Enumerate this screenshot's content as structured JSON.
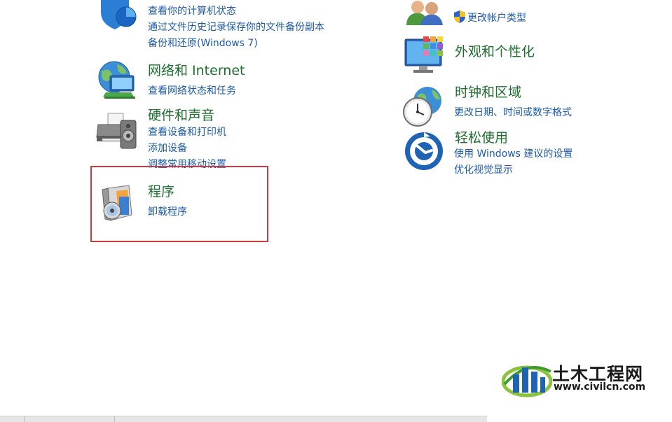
{
  "left_column": [
    {
      "id": "system-security",
      "title": "",
      "links": [
        "查看你的计算机状态",
        "通过文件历史记录保存你的文件备份副本",
        "备份和还原(Windows 7)"
      ]
    },
    {
      "id": "network",
      "title": "网络和 Internet",
      "links": [
        "查看网络状态和任务"
      ]
    },
    {
      "id": "hardware",
      "title": "硬件和声音",
      "links": [
        "查看设备和打印机",
        "添加设备",
        "调整常用移动设置"
      ]
    },
    {
      "id": "programs",
      "title": "程序",
      "links": [
        "卸载程序"
      ]
    }
  ],
  "right_column": [
    {
      "id": "user-accounts",
      "title": "",
      "links": [
        "更改帐户类型"
      ]
    },
    {
      "id": "appearance",
      "title": "外观和个性化",
      "links": []
    },
    {
      "id": "clock-region",
      "title": "时钟和区域",
      "links": [
        "更改日期、时间或数字格式"
      ]
    },
    {
      "id": "ease-of-access",
      "title": "轻松使用",
      "links": [
        "使用 Windows 建议的设置",
        "优化视觉显示"
      ]
    }
  ],
  "icons": {
    "system-security": "shield-globe-icon",
    "network": "network-globe-icon",
    "hardware": "printer-speaker-icon",
    "programs": "programs-disc-icon",
    "user-accounts": "users-icon",
    "appearance": "monitor-palette-icon",
    "clock-region": "clock-globe-icon",
    "ease-of-access": "ease-of-access-icon",
    "admin-shield": "uac-shield-icon"
  },
  "colors": {
    "title_green": "#1e6f2f",
    "link_blue": "#1c5aa8",
    "highlight_red": "#d03a3a"
  },
  "watermark": {
    "main": "土木工程网",
    "sub": "www.civilcn.com"
  }
}
